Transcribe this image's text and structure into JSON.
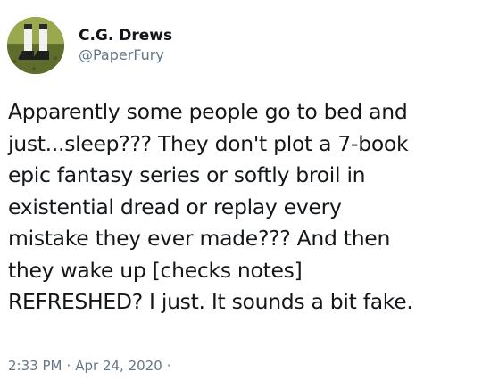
{
  "tweet": {
    "author": {
      "display_name": "C.G. Drews",
      "handle": "@PaperFury",
      "avatar_icon": "profile-photo-icon"
    },
    "text_lines": [
      "Apparently some people go to bed and",
      "just...sleep??? They don't plot a 7-book",
      "epic fantasy series or softly broil in",
      "existential dread or replay every",
      "mistake they ever made??? And then",
      "they wake up [checks notes]",
      "REFRESHED? I just. It sounds a bit fake."
    ],
    "meta": {
      "time": "2:33 PM",
      "separator": "·",
      "date": "Apr 24, 2020",
      "trailing_separator": "·"
    }
  },
  "colors": {
    "text_primary": "#14171a",
    "text_secondary": "#657786",
    "background": "#ffffff"
  }
}
